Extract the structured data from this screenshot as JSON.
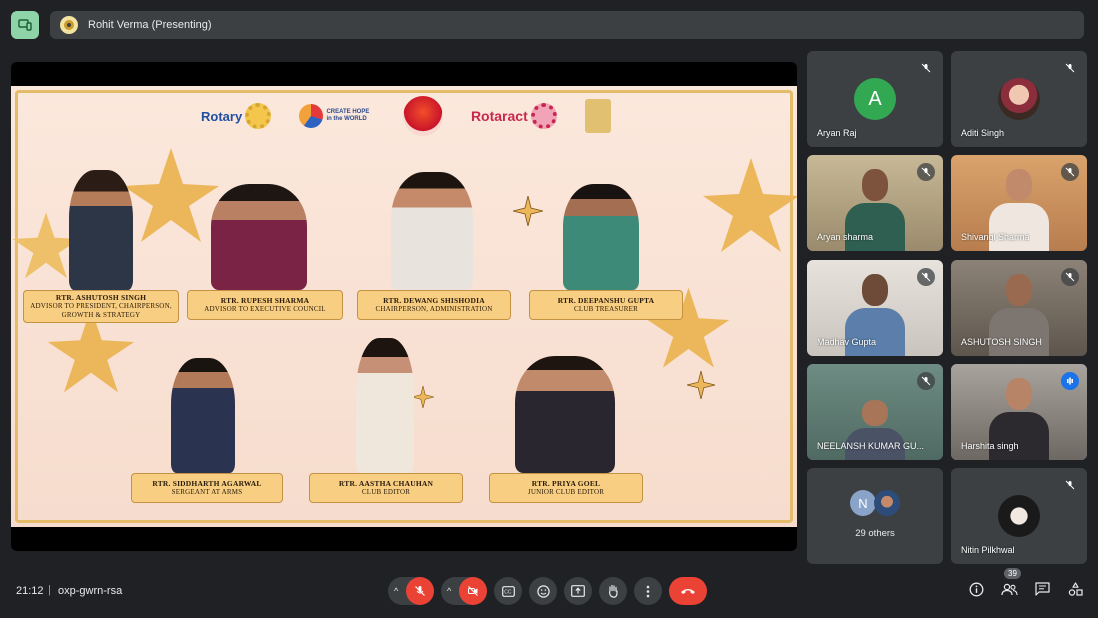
{
  "presenter": {
    "label": "Rohit Verma (Presenting)"
  },
  "slide": {
    "logos": {
      "rotary": "Rotary",
      "hope": "CREATE HOPE in the WORLD",
      "rotaract": "Rotaract"
    },
    "members": [
      {
        "name": "RTR. ASHUTOSH SINGH",
        "role": "ADVISOR TO PRESIDENT, CHAIRPERSON, GROWTH & STRATEGY"
      },
      {
        "name": "RTR. RUPESH SHARMA",
        "role": "ADVISOR TO EXECUTIVE COUNCIL"
      },
      {
        "name": "RTR. DEWANG SHISHODIA",
        "role": "CHAIRPERSON, ADMINISTRATION"
      },
      {
        "name": "RTR. DEEPANSHU GUPTA",
        "role": "CLUB TREASURER"
      },
      {
        "name": "RTR. SIDDHARTH AGARWAL",
        "role": "SERGEANT AT ARMS"
      },
      {
        "name": "RTR. AASTHA CHAUHAN",
        "role": "CLUB EDITOR"
      },
      {
        "name": "RTR. PRIYA GOEL",
        "role": "JUNIOR CLUB EDITOR"
      }
    ]
  },
  "participants": [
    {
      "name": "Aryan Raj",
      "avatar": "A",
      "muted": true,
      "color": "#33a852"
    },
    {
      "name": "Aditi Singh",
      "muted": true
    },
    {
      "name": "Aryan sharma",
      "muted": true
    },
    {
      "name": "Shivangi Sharma",
      "muted": true
    },
    {
      "name": "Madhav Gupta",
      "muted": true
    },
    {
      "name": "ASHUTOSH SINGH",
      "muted": true
    },
    {
      "name": "NEELANSH KUMAR GU...",
      "muted": true
    },
    {
      "name": "Harshita singh",
      "muted": false,
      "speaking": true
    },
    {
      "name": "29 others",
      "avatar": "N"
    },
    {
      "name": "Nitin Pilkhwal",
      "muted": true
    }
  ],
  "bottom": {
    "time": "21:12",
    "separator": "|",
    "meeting_code": "oxp-gwrn-rsa",
    "people_count": "39"
  },
  "icons": {
    "mic": "mic-off-icon",
    "camera": "camera-off-icon",
    "captions": "captions-icon",
    "emoji": "emoji-icon",
    "present": "present-screen-icon",
    "hand": "raise-hand-icon",
    "more": "more-options-icon",
    "end": "end-call-icon",
    "info": "info-icon",
    "people": "people-icon",
    "chat": "chat-icon",
    "activities": "activities-icon"
  },
  "colors": {
    "accent": "#8ab4f8",
    "danger": "#ea4335",
    "bg": "#202124"
  }
}
